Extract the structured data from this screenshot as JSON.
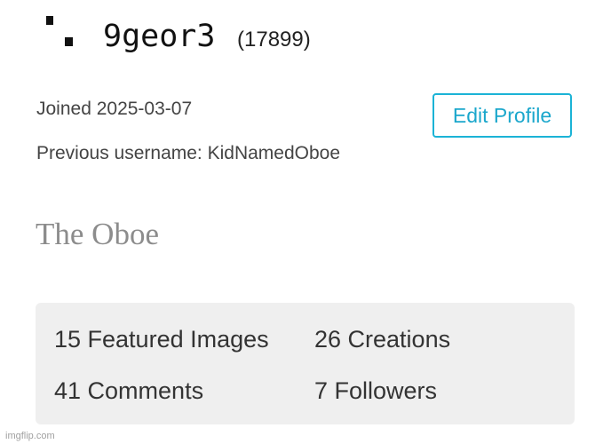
{
  "profile": {
    "username": "9geor3",
    "points": "(17899)",
    "joined": "Joined 2025-03-07",
    "previous_username": "Previous username: KidNamedOboe",
    "bio": "The Oboe",
    "edit_label": "Edit Profile"
  },
  "stats": {
    "featured": "15 Featured Images",
    "creations": "26 Creations",
    "comments": "41 Comments",
    "followers": "7 Followers"
  },
  "watermark": "imgflip.com",
  "colors": {
    "accent": "#1bb3d6",
    "stats_bg": "#efefef",
    "bio_text": "#8c8c8c"
  }
}
